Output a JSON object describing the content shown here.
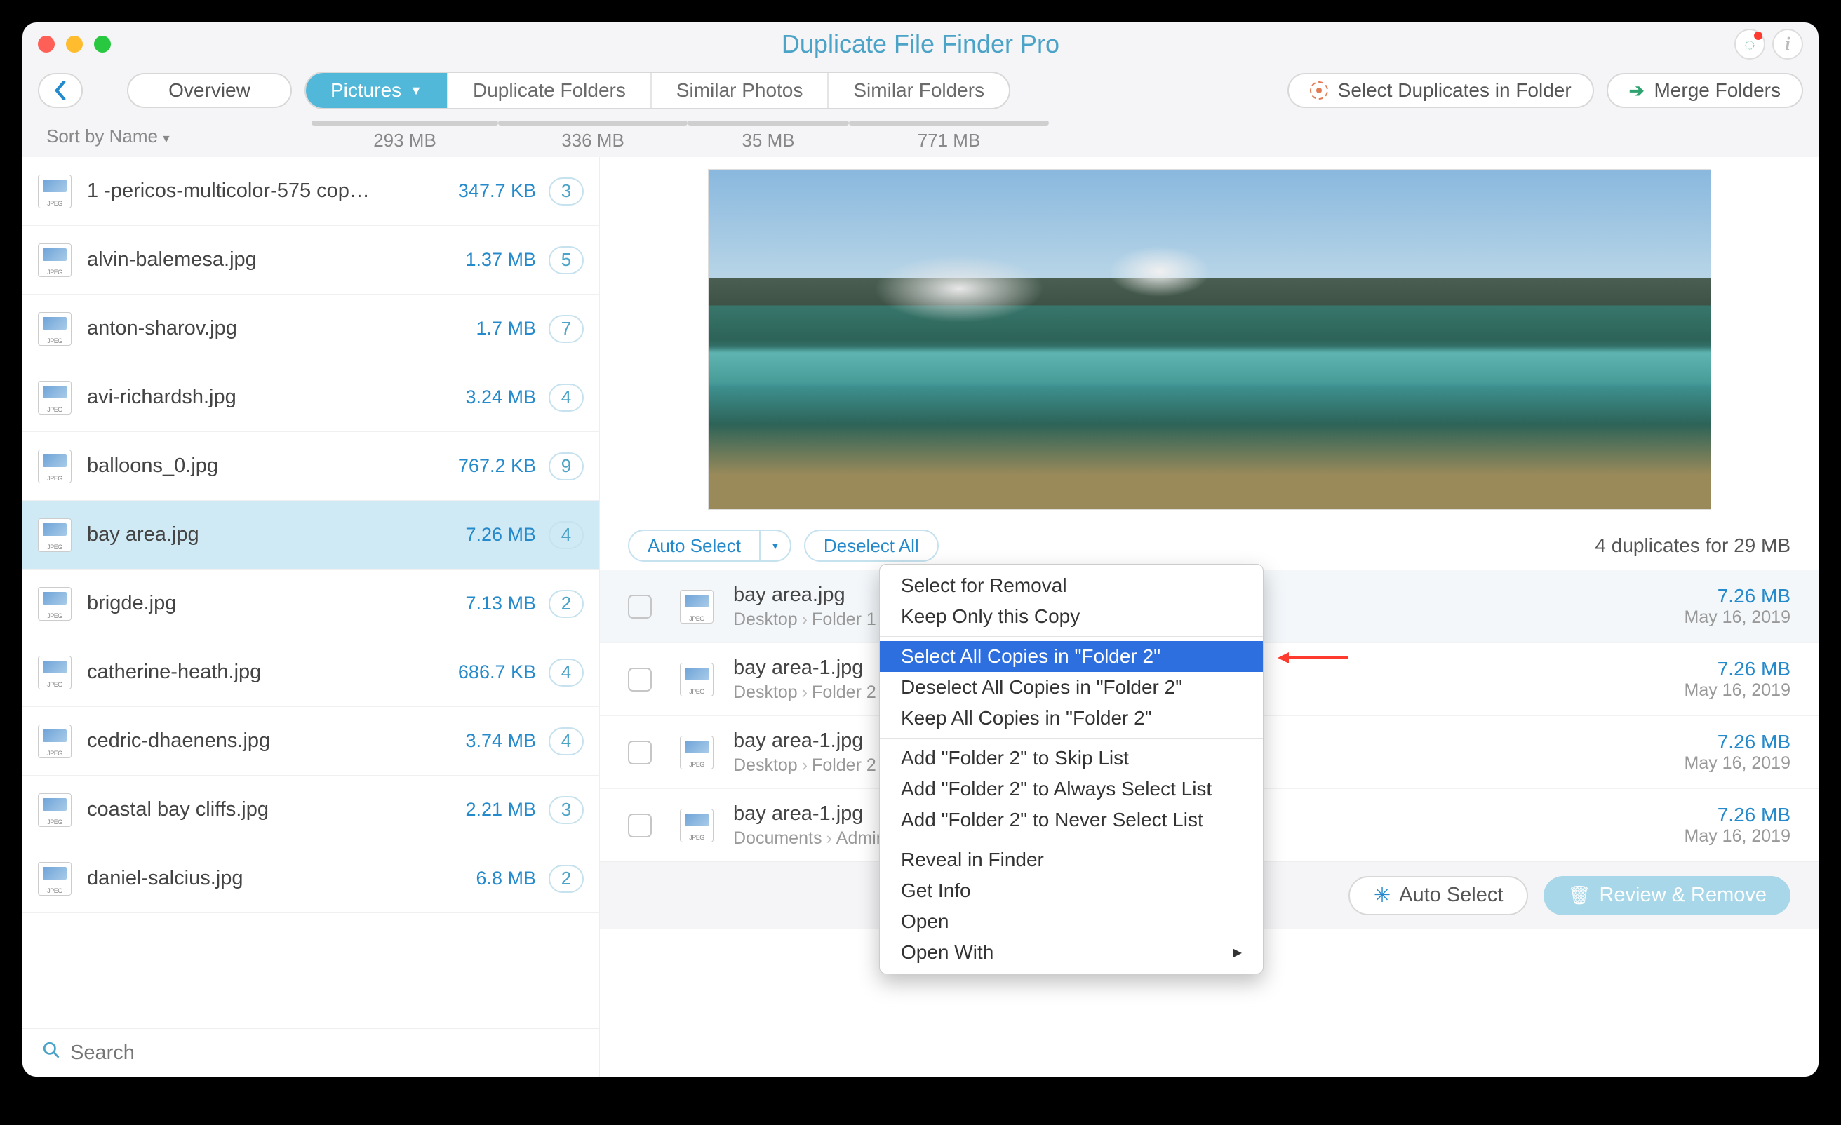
{
  "window": {
    "title": "Duplicate File Finder Pro"
  },
  "toolbar": {
    "overview": "Overview",
    "tabs": [
      {
        "label": "Pictures",
        "size": "293 MB",
        "bar": 266
      },
      {
        "label": "Duplicate Folders",
        "size": "336 MB",
        "bar": 270
      },
      {
        "label": "Similar Photos",
        "size": "35 MB",
        "bar": 230
      },
      {
        "label": "Similar Folders",
        "size": "771 MB",
        "bar": 285
      }
    ],
    "select_in_folder": "Select Duplicates in Folder",
    "merge_folders": "Merge Folders"
  },
  "sidebar": {
    "sort_label": "Sort by Name",
    "search_placeholder": "Search",
    "items": [
      {
        "name": "1 -pericos-multicolor-575 cop…",
        "size": "347.7 KB",
        "count": 3
      },
      {
        "name": "alvin-balemesa.jpg",
        "size": "1.37 MB",
        "count": 5
      },
      {
        "name": "anton-sharov.jpg",
        "size": "1.7 MB",
        "count": 7
      },
      {
        "name": "avi-richardsh.jpg",
        "size": "3.24 MB",
        "count": 4
      },
      {
        "name": "balloons_0.jpg",
        "size": "767.2 KB",
        "count": 9
      },
      {
        "name": "bay area.jpg",
        "size": "7.26 MB",
        "count": 4,
        "selected": true
      },
      {
        "name": "brigde.jpg",
        "size": "7.13 MB",
        "count": 2
      },
      {
        "name": "catherine-heath.jpg",
        "size": "686.7 KB",
        "count": 4
      },
      {
        "name": "cedric-dhaenens.jpg",
        "size": "3.74 MB",
        "count": 4
      },
      {
        "name": "coastal bay cliffs.jpg",
        "size": "2.21 MB",
        "count": 3
      },
      {
        "name": "daniel-salcius.jpg",
        "size": "6.8 MB",
        "count": 2
      }
    ]
  },
  "detail": {
    "auto_select_small": "Auto Select",
    "deselect_all": "Deselect All",
    "summary": "4 duplicates for 29 MB",
    "duplicates": [
      {
        "name": "bay area.jpg",
        "path": [
          "Desktop",
          "Folder 1"
        ],
        "size": "7.26 MB",
        "date": "May 16, 2019",
        "hl": true
      },
      {
        "name": "bay area-1.jpg",
        "path": [
          "Desktop",
          "Folder 2"
        ],
        "size": "7.26 MB",
        "date": "May 16, 2019"
      },
      {
        "name": "bay area-1.jpg",
        "path": [
          "Desktop",
          "Folder 2"
        ],
        "size": "7.26 MB",
        "date": "May 16, 2019"
      },
      {
        "name": "bay area-1.jpg",
        "path": [
          "Documents",
          "Admin"
        ],
        "size": "7.26 MB",
        "date": "May 16, 2019"
      }
    ]
  },
  "context_menu": {
    "items": [
      {
        "label": "Select for Removal"
      },
      {
        "label": "Keep Only this Copy"
      },
      {
        "sep": true
      },
      {
        "label": "Select All Copies in \"Folder 2\"",
        "highlight": true
      },
      {
        "label": "Deselect All Copies in \"Folder 2\""
      },
      {
        "label": "Keep All Copies in \"Folder 2\""
      },
      {
        "sep": true
      },
      {
        "label": "Add \"Folder 2\" to Skip List"
      },
      {
        "label": "Add \"Folder 2\" to Always Select List"
      },
      {
        "label": "Add \"Folder 2\" to Never Select List"
      },
      {
        "sep": true
      },
      {
        "label": "Reveal in Finder"
      },
      {
        "label": "Get Info"
      },
      {
        "label": "Open"
      },
      {
        "label": "Open With",
        "submenu": true
      }
    ]
  },
  "footer": {
    "auto_select": "Auto Select",
    "review_remove": "Review & Remove"
  }
}
